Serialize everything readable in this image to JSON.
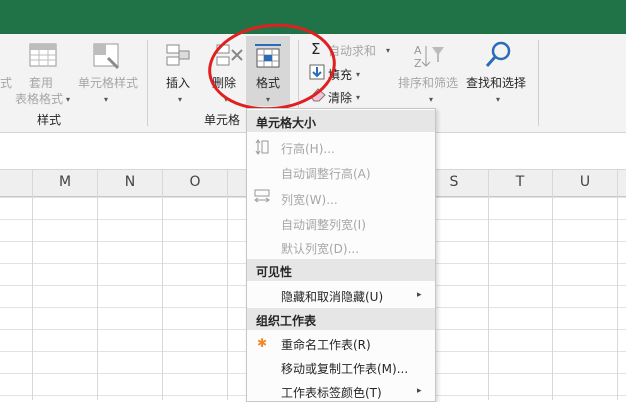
{
  "ribbon": {
    "styles_group": {
      "partial_left": "式",
      "table_format_l1": "套用",
      "table_format_l2": "表格格式",
      "cell_styles": "单元格样式",
      "label": "样式"
    },
    "cells_group": {
      "insert": "插入",
      "delete": "删除",
      "format": "格式",
      "label": "单元格"
    },
    "editing_group": {
      "autosum": "自动求和",
      "fill": "填充",
      "clear": "清除",
      "sort_filter": "排序和筛选",
      "find_select": "查找和选择"
    }
  },
  "columns": [
    "M",
    "N",
    "O",
    "S",
    "T",
    "U"
  ],
  "menu": {
    "sections": [
      {
        "title": "单元格大小",
        "items": [
          {
            "label": "行高(H)...",
            "enabled": false
          },
          {
            "label": "自动调整行高(A)",
            "enabled": false
          },
          {
            "label": "列宽(W)...",
            "enabled": false
          },
          {
            "label": "自动调整列宽(I)",
            "enabled": false
          },
          {
            "label": "默认列宽(D)...",
            "enabled": false
          }
        ]
      },
      {
        "title": "可见性",
        "items": [
          {
            "label": "隐藏和取消隐藏(U)",
            "enabled": true,
            "submenu": true
          }
        ]
      },
      {
        "title": "组织工作表",
        "items": [
          {
            "label": "重命名工作表(R)",
            "enabled": true
          },
          {
            "label": "移动或复制工作表(M)...",
            "enabled": true
          },
          {
            "label": "工作表标签颜色(T)",
            "enabled": true,
            "submenu": true
          }
        ]
      }
    ]
  },
  "colors": {
    "title_bar": "#1f7346",
    "highlight_circle": "#e02020",
    "accent_icon": "#2b6cb8"
  }
}
